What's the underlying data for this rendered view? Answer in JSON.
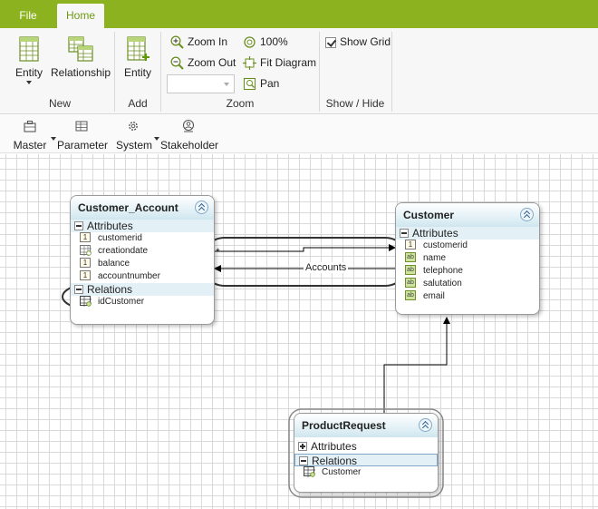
{
  "tabs": {
    "file": "File",
    "home": "Home"
  },
  "ribbon": {
    "new_group": {
      "label": "New",
      "entity": "Entity",
      "relationship": "Relationship"
    },
    "add_group": {
      "label": "Add",
      "entity": "Entity"
    },
    "zoom_group": {
      "label": "Zoom",
      "zoom_in": "Zoom In",
      "zoom_out": "Zoom Out",
      "hundred": "100%",
      "fit": "Fit Diagram",
      "pan": "Pan",
      "zoom_value": ""
    },
    "show_group": {
      "label": "Show / Hide",
      "show_grid": "Show Grid",
      "show_grid_checked": true
    }
  },
  "toolbar2": {
    "master": "Master",
    "parameter": "Parameter",
    "system": "System",
    "stakeholder": "Stakeholder"
  },
  "diagram": {
    "customer_account": {
      "title": "Customer_Account",
      "attributes_label": "Attributes",
      "attributes": [
        {
          "name": "customerid",
          "type": "number"
        },
        {
          "name": "creationdate",
          "type": "date"
        },
        {
          "name": "balance",
          "type": "number"
        },
        {
          "name": "accountnumber",
          "type": "number"
        }
      ],
      "relations_label": "Relations",
      "relations": [
        {
          "name": "idCustomer"
        }
      ]
    },
    "customer": {
      "title": "Customer",
      "attributes_label": "Attributes",
      "attributes": [
        {
          "name": "customerid",
          "type": "number"
        },
        {
          "name": "name",
          "type": "text"
        },
        {
          "name": "telephone",
          "type": "text"
        },
        {
          "name": "salutation",
          "type": "text"
        },
        {
          "name": "email",
          "type": "text"
        }
      ]
    },
    "product_request": {
      "title": "ProductRequest",
      "attributes_label": "Attributes",
      "relations_label": "Relations",
      "relations": [
        {
          "name": "Customer"
        }
      ]
    },
    "relationship_label": "Accounts",
    "relationship_multiplicity": "*"
  },
  "colors": {
    "accent": "#8cb31f",
    "entity_header": "#cfe6ef",
    "section": "#e3f0f6"
  }
}
